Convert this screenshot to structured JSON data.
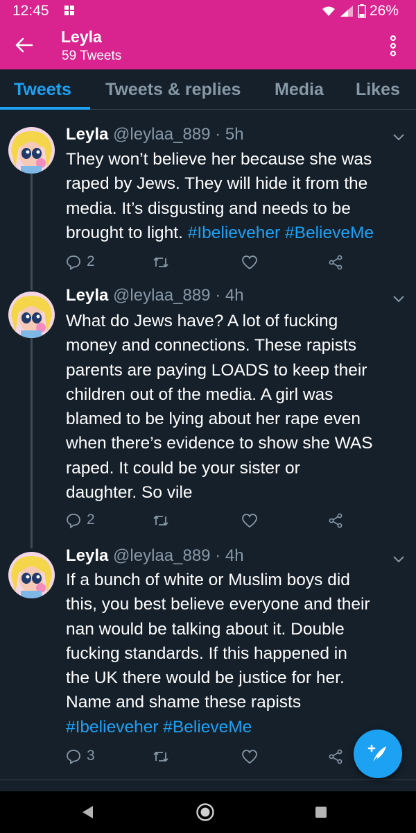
{
  "status_bar": {
    "time": "12:45",
    "battery": "26%",
    "background_color": "#d9238e"
  },
  "profile": {
    "name": "Leyla",
    "tweet_count": "59 Tweets"
  },
  "tabs": [
    {
      "label": "Tweets",
      "active": true
    },
    {
      "label": "Tweets & replies",
      "active": false
    },
    {
      "label": "Media",
      "active": false
    },
    {
      "label": "Likes",
      "active": false
    }
  ],
  "tweets": [
    {
      "name": "Leyla",
      "handle": "@leylaa_889",
      "separator": "·",
      "time": "5h",
      "body_lines": [
        [
          {
            "text": "They won’t believe her because she was"
          }
        ],
        [
          {
            "text": "raped by Jews. They will hide it from the"
          }
        ],
        [
          {
            "text": "media. It’s disgusting and needs to be"
          }
        ],
        [
          {
            "text": "brought to light. "
          },
          {
            "text": "#Ibelieveher",
            "hashtag": true
          },
          {
            "text": " "
          },
          {
            "text": "#BelieveMe",
            "hashtag": true
          }
        ]
      ],
      "reply_count": "2"
    },
    {
      "name": "Leyla",
      "handle": "@leylaa_889",
      "separator": "·",
      "time": "4h",
      "body_lines": [
        [
          {
            "text": "What do Jews have? A lot of fucking"
          }
        ],
        [
          {
            "text": "money and connections. These rapists"
          }
        ],
        [
          {
            "text": "parents are paying LOADS to keep their"
          }
        ],
        [
          {
            "text": "children out of the media. A girl was"
          }
        ],
        [
          {
            "text": "blamed to be lying about her rape even"
          }
        ],
        [
          {
            "text": "when there’s evidence to show she WAS"
          }
        ],
        [
          {
            "text": "raped. It could be your sister or"
          }
        ],
        [
          {
            "text": "daughter. So vile"
          }
        ]
      ],
      "reply_count": "2"
    },
    {
      "name": "Leyla",
      "handle": "@leylaa_889",
      "separator": "·",
      "time": "4h",
      "body_lines": [
        [
          {
            "text": "If a bunch of white or Muslim boys did"
          }
        ],
        [
          {
            "text": "this, you best believe everyone and their"
          }
        ],
        [
          {
            "text": "nan would be talking about it. Double"
          }
        ],
        [
          {
            "text": "fucking standards. If this happened in"
          }
        ],
        [
          {
            "text": "the UK there would be justice for her."
          }
        ],
        [
          {
            "text": "Name and shame these rapists"
          }
        ],
        [
          {
            "text": "#Ibelieveher",
            "hashtag": true
          },
          {
            "text": " "
          },
          {
            "text": "#BelieveMe",
            "hashtag": true
          }
        ]
      ],
      "reply_count": "3"
    }
  ],
  "colors": {
    "background": "#15202b",
    "accent": "#1da1f2",
    "muted_text": "#8899a6",
    "appbar": "#d9238e"
  },
  "icons": {
    "status": [
      "notification-icon",
      "wifi-icon",
      "signal-icon",
      "battery-icon"
    ],
    "appbar": [
      "back-arrow-icon",
      "more-vert-icon"
    ],
    "tweet_actions": [
      "reply-icon",
      "retweet-icon",
      "like-icon",
      "share-icon"
    ],
    "fab": "compose-tweet-icon",
    "system_nav": [
      "nav-back-icon",
      "nav-home-icon",
      "nav-recents-icon"
    ]
  }
}
